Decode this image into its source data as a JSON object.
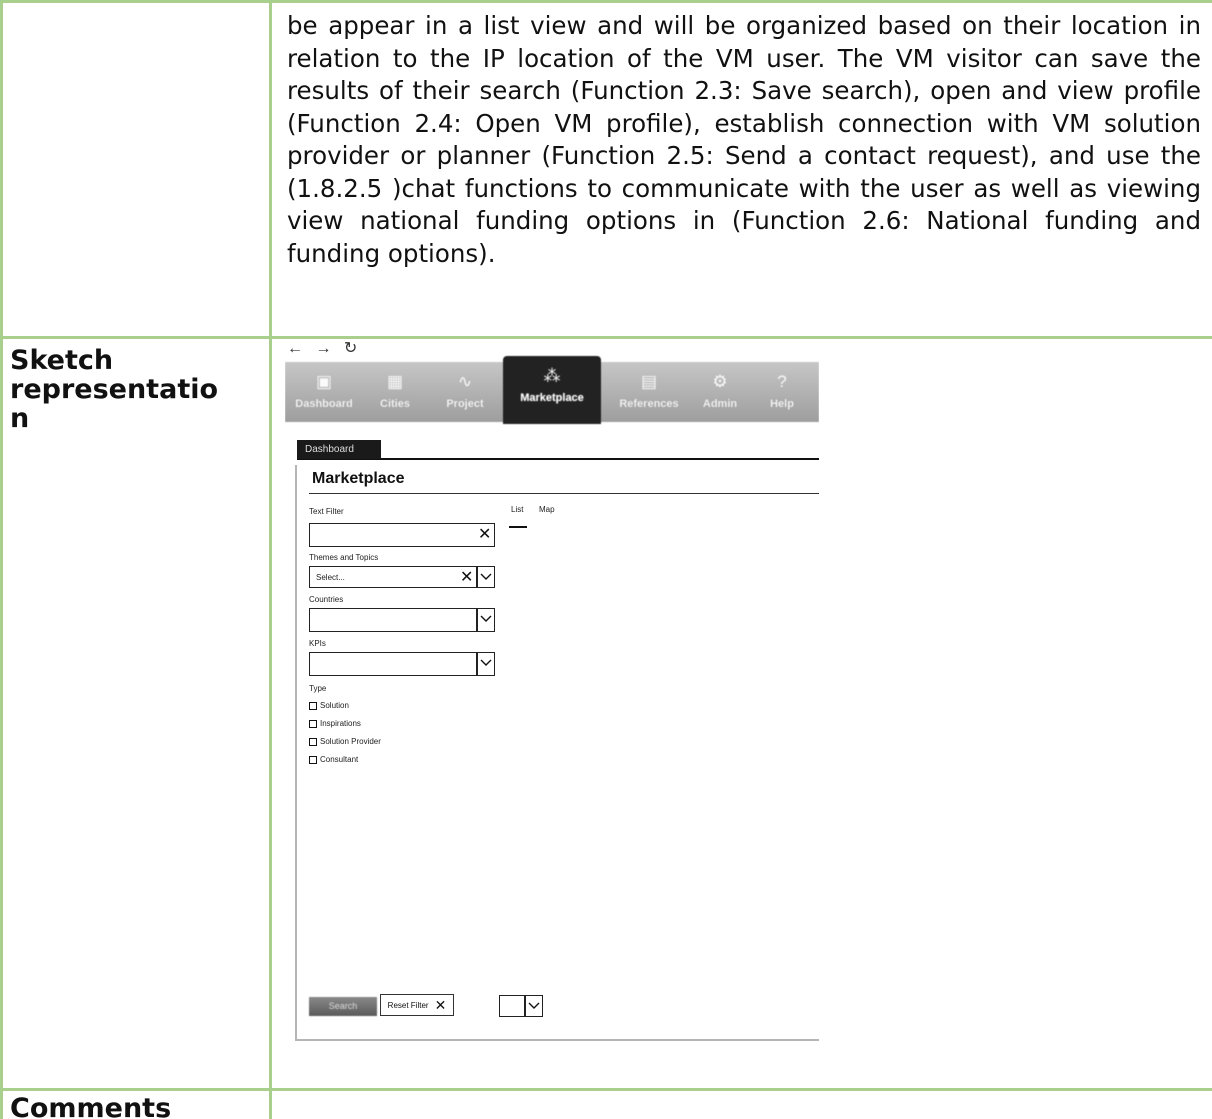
{
  "document": {
    "paragraph": "be appear in a list view and will be organized based on their location in relation to the IP location of the VM user. The VM visitor can save the results of their search (Function 2.3: Save search), open and view profile (Function 2.4: Open VM profile), establish connection with VM solution provider or planner (Function 2.5: Send a contact request), and use the (1.8.2.5 )chat functions to communicate with the user as well as viewing view national funding options in (Function 2.6: National funding and funding options).",
    "row_labels": {
      "sketch_line1": "Sketch",
      "sketch_line2": "representatio",
      "sketch_line3": "n",
      "comments": "Comments"
    },
    "table_border_color": "#a9cf8c"
  },
  "sketch": {
    "browser_controls": "← → ↻",
    "nav_items": [
      {
        "label": "Dashboard",
        "icon": "dashboard-icon",
        "glyph": "▣"
      },
      {
        "label": "Cities",
        "icon": "cities-icon",
        "glyph": "▦"
      },
      {
        "label": "Project",
        "icon": "project-icon",
        "glyph": "∿"
      },
      {
        "label": "Marketplace",
        "icon": "marketplace-icon",
        "glyph": "⁂"
      },
      {
        "label": "References",
        "icon": "references-icon",
        "glyph": "▤"
      },
      {
        "label": "Admin",
        "icon": "gear-icon",
        "glyph": "⚙"
      },
      {
        "label": "Help",
        "icon": "help-icon",
        "glyph": "?"
      }
    ],
    "active_nav": "Marketplace",
    "breadcrumb": "Dashboard",
    "page_title": "Marketplace",
    "text_filter": {
      "label": "Text Filter",
      "value": ""
    },
    "themes": {
      "label": "Themes and Topics",
      "placeholder": "Select..."
    },
    "countries": {
      "label": "Countries",
      "value": ""
    },
    "kpis": {
      "label": "KPIs",
      "value": ""
    },
    "type": {
      "label": "Type",
      "options": [
        "Solution",
        "Inspirations",
        "Solution Provider",
        "Consultant"
      ]
    },
    "view_tabs": {
      "list": "List",
      "map": "Map",
      "active": "List"
    },
    "search_button": "Search",
    "reset_button": "Reset Filter"
  }
}
